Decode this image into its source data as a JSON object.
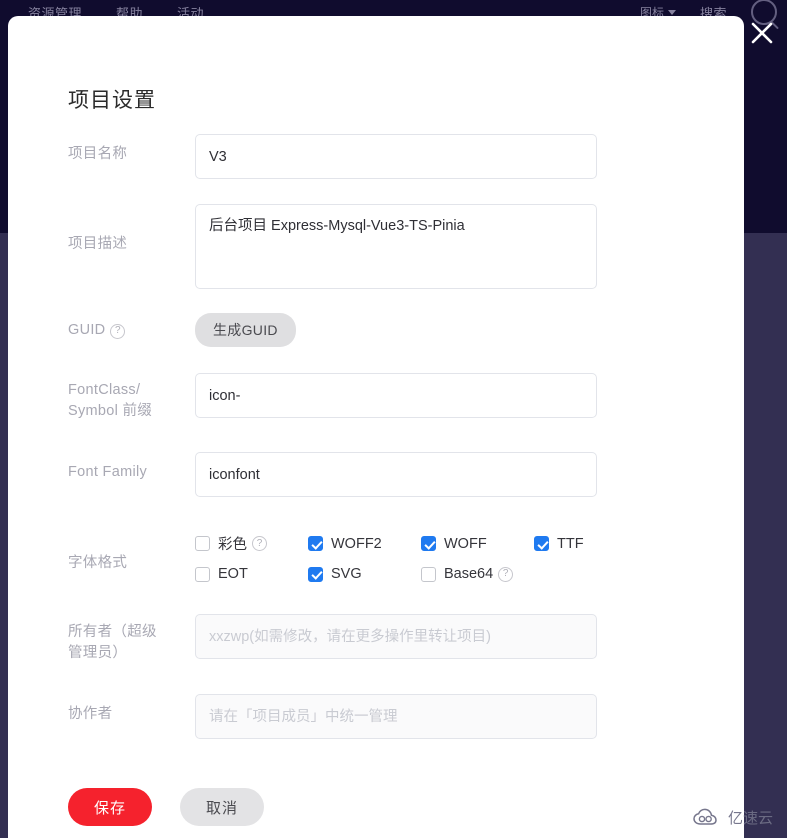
{
  "background": {
    "topnav": {
      "items": [
        {
          "label": "资源管理"
        },
        {
          "label": "帮助"
        },
        {
          "label": "活动"
        }
      ],
      "right": {
        "select_label": "图标",
        "link_label": "搜索",
        "search_icon": "search-icon"
      }
    },
    "colors": {
      "top": "#100c2e",
      "bottom": "#332f52"
    }
  },
  "modal": {
    "title": "项目设置",
    "close_icon": "close-icon",
    "fields": {
      "project_name": {
        "label": "项目名称",
        "value": "V3",
        "placeholder": ""
      },
      "project_desc": {
        "label": "项目描述",
        "value": "后台项目 Express-Mysql-Vue3-TS-Pinia",
        "placeholder": ""
      },
      "guid": {
        "label": "GUID",
        "help_icon": "question-circle-icon",
        "button_label": "生成GUID"
      },
      "font_class_prefix": {
        "label_line1": "FontClass/",
        "label_line2": "Symbol 前缀",
        "value": "icon-",
        "placeholder": ""
      },
      "font_family": {
        "label": "Font Family",
        "value": "iconfont",
        "placeholder": ""
      },
      "font_formats": {
        "label": "字体格式",
        "rows": [
          [
            {
              "label": "彩色",
              "checked": false,
              "help_icon": "question-circle-icon"
            },
            {
              "label": "WOFF2",
              "checked": true,
              "help_icon": null
            },
            {
              "label": "WOFF",
              "checked": true,
              "help_icon": null
            },
            {
              "label": "TTF",
              "checked": true,
              "help_icon": null
            }
          ],
          [
            {
              "label": "EOT",
              "checked": false,
              "help_icon": null
            },
            {
              "label": "SVG",
              "checked": true,
              "help_icon": null
            },
            {
              "label": "Base64",
              "checked": false,
              "help_icon": "question-circle-icon"
            }
          ]
        ]
      },
      "owner": {
        "label_line1": "所有者（超级",
        "label_line2": "管理员）",
        "value": "",
        "placeholder": "xxzwp(如需修改，请在更多操作里转让项目)"
      },
      "collaborators": {
        "label": "协作者",
        "value": "",
        "placeholder": "请在「项目成员」中统一管理"
      }
    },
    "footer": {
      "save_label": "保存",
      "cancel_label": "取消",
      "save_color": "#f5222d"
    }
  },
  "watermark": {
    "text": "亿速云",
    "logo_icon": "cloud-logo-icon"
  }
}
